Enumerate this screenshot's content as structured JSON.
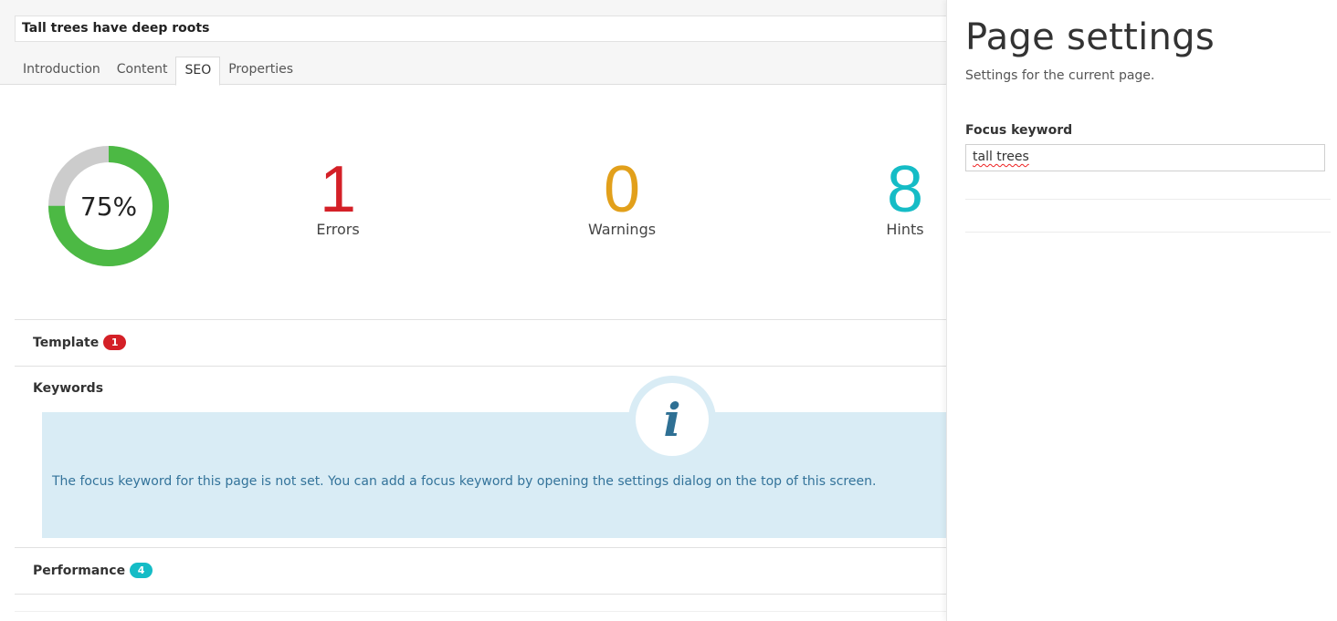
{
  "document": {
    "name": "Tall trees have deep roots"
  },
  "tabs": [
    {
      "label": "Introduction",
      "active": false
    },
    {
      "label": "Content",
      "active": false
    },
    {
      "label": "SEO",
      "active": true
    },
    {
      "label": "Properties",
      "active": false
    }
  ],
  "score": {
    "percent_label": "75%",
    "fraction": 0.75,
    "colors": {
      "fill": "#4cb944",
      "track": "#cccccc"
    }
  },
  "stats": {
    "errors": {
      "value": "1",
      "label": "Errors",
      "color": "#d42027"
    },
    "warnings": {
      "value": "0",
      "label": "Warnings",
      "color": "#e2a01b"
    },
    "hints": {
      "value": "8",
      "label": "Hints",
      "color": "#15bcc6"
    }
  },
  "sections": {
    "template": {
      "title": "Template",
      "badge": "1",
      "badge_color": "#d42027"
    },
    "keywords": {
      "title": "Keywords",
      "info_icon": "info-icon",
      "info_text": "The focus keyword for this page is not set. You can add a focus keyword by opening the settings dialog on the top of this screen."
    },
    "performance": {
      "title": "Performance",
      "badge": "4",
      "badge_color": "#15bcc6"
    }
  },
  "panel": {
    "title": "Page settings",
    "subtitle": "Settings for the current page.",
    "focus_keyword_label": "Focus keyword",
    "focus_keyword_value": "tall trees"
  }
}
